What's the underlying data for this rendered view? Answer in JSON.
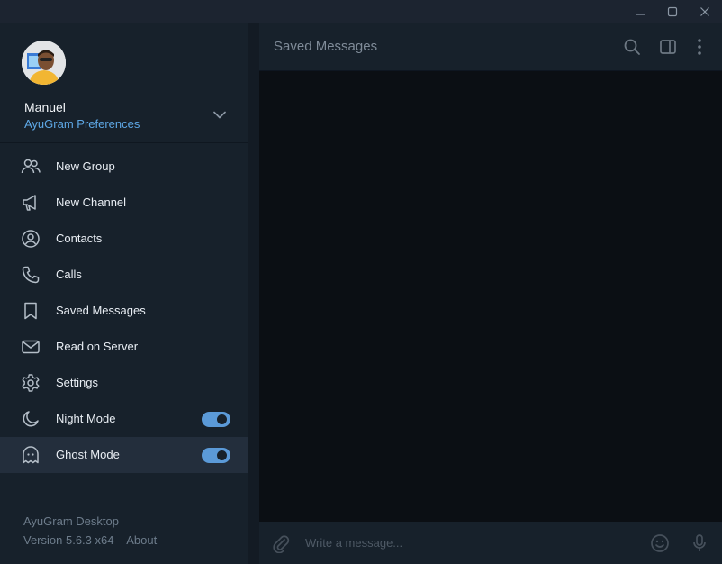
{
  "window": {
    "controls": [
      {
        "name": "minimize-button",
        "icon": "minimize-icon"
      },
      {
        "name": "maximize-button",
        "icon": "maximize-icon"
      },
      {
        "name": "close-button",
        "icon": "close-icon"
      }
    ]
  },
  "account": {
    "name": "Manuel",
    "subtitle": "AyuGram Preferences",
    "avatar_icon": "user-avatar"
  },
  "menu": {
    "items": [
      {
        "label": "New Group",
        "icon": "group-icon"
      },
      {
        "label": "New Channel",
        "icon": "megaphone-icon"
      },
      {
        "label": "Contacts",
        "icon": "contact-icon"
      },
      {
        "label": "Calls",
        "icon": "phone-icon"
      },
      {
        "label": "Saved Messages",
        "icon": "bookmark-icon"
      },
      {
        "label": "Read on Server",
        "icon": "envelope-icon"
      },
      {
        "label": "Settings",
        "icon": "gear-icon"
      },
      {
        "label": "Night Mode",
        "icon": "moon-icon",
        "toggle": true
      },
      {
        "label": "Ghost Mode",
        "icon": "ghost-icon",
        "toggle": true
      }
    ]
  },
  "footer": {
    "app_name": "AyuGram Desktop",
    "version": "Version 5.6.3 x64 – ",
    "about": "About"
  },
  "chat": {
    "title": "Saved Messages",
    "input_placeholder": "Write a message..."
  },
  "colors": {
    "accent": "#5ea8e6",
    "toggle_on": "#5b9ad8",
    "drawer_bg": "#17212b",
    "hover_bg": "#232e3c"
  }
}
